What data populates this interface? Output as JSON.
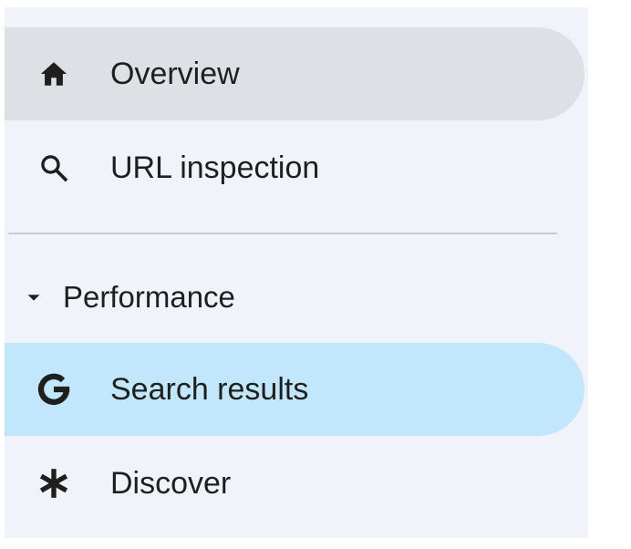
{
  "nav": {
    "items": [
      {
        "label": "Overview",
        "icon": "home-icon",
        "state": "hover"
      },
      {
        "label": "URL inspection",
        "icon": "search-icon",
        "state": "normal"
      }
    ],
    "sections": [
      {
        "title": "Performance",
        "expanded": true,
        "icon": "caret-down-icon",
        "items": [
          {
            "label": "Search results",
            "icon": "google-g-icon",
            "state": "selected"
          },
          {
            "label": "Discover",
            "icon": "asterisk-icon",
            "state": "normal"
          }
        ]
      }
    ]
  },
  "colors": {
    "panel_background": "#f0f3f9",
    "hover_background": "#dde1e6",
    "selected_background": "#c2e6fb",
    "divider": "#c9ccd1",
    "text": "#1f1f1f"
  }
}
